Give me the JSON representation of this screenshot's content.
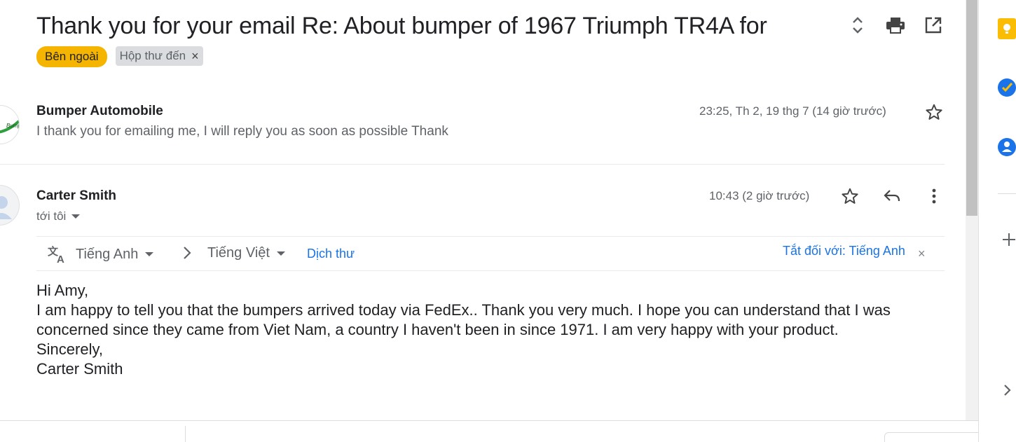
{
  "thread": {
    "subject": "Thank you for your email Re: About bumper of 1967 Triumph TR4A for",
    "labels": {
      "external": "Bên ngoài",
      "inbox": "Hộp thư đến",
      "inbox_remove": "×"
    },
    "actions": {
      "expand_icon": "unfold-icon",
      "print_icon": "print-icon",
      "new_window_icon": "open-in-new-icon"
    }
  },
  "messages": [
    {
      "sender": "Bumper Automobile",
      "avatar_text": "Bumper",
      "snippet": "I thank you for emailing me, I will reply you as soon as possible Thank",
      "time": "23:25, Th 2, 19 thg 7 (14 giờ trước)",
      "star_icon": "star-outline-icon"
    },
    {
      "sender": "Carter Smith",
      "recipient": "tới tôi",
      "time": "10:43 (2 giờ trước)",
      "star_icon": "star-outline-icon",
      "reply_icon": "reply-icon",
      "more_icon": "more-vert-icon",
      "body": [
        "Hi Amy,",
        "I am happy to tell you that the bumpers arrived today via FedEx..  Thank you very much.  I hope you can understand that I was concerned since they came from Viet Nam, a country I haven't been in since 1971.  I am very happy with your product.",
        "Sincerely,",
        "Carter Smith"
      ]
    }
  ],
  "translation": {
    "from_lang": "Tiếng Anh",
    "to_lang": "Tiếng Việt",
    "translate_link": "Dịch thư",
    "turn_off": "Tắt đối với: Tiếng Anh",
    "close": "×"
  },
  "colors": {
    "external_chip": "#f4b400",
    "link": "#1a73e8",
    "keep_yellow": "#fbbc04",
    "tasks_blue": "#1a73e8",
    "contacts_blue": "#1a73e8"
  },
  "side_panel": {
    "icons": [
      "keep-icon",
      "tasks-icon",
      "contacts-icon",
      "add-icon",
      "chevron-right-icon"
    ]
  }
}
